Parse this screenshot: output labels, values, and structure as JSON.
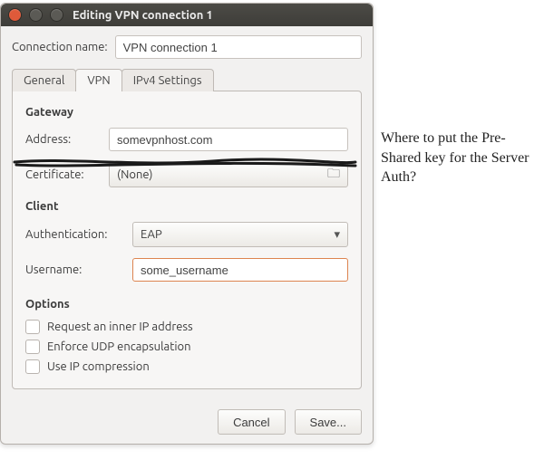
{
  "window": {
    "title": "Editing VPN connection 1"
  },
  "conn_name": {
    "label": "Connection name:",
    "value": "VPN connection 1"
  },
  "tabs": {
    "general": "General",
    "vpn": "VPN",
    "ipv4": "IPv4 Settings"
  },
  "gateway": {
    "title": "Gateway",
    "address_label": "Address:",
    "address_value": "somevpnhost.com",
    "certificate_label": "Certificate:",
    "certificate_value": "(None)"
  },
  "client": {
    "title": "Client",
    "auth_label": "Authentication:",
    "auth_value": "EAP",
    "user_label": "Username:",
    "user_value": "some_username"
  },
  "options": {
    "title": "Options",
    "request_ip": "Request an inner IP address",
    "enforce_udp": "Enforce UDP encapsulation",
    "ip_compression": "Use IP compression"
  },
  "buttons": {
    "cancel": "Cancel",
    "save": "Save..."
  },
  "annotation": "Where to put the Pre-Shared key for the Server Auth?"
}
